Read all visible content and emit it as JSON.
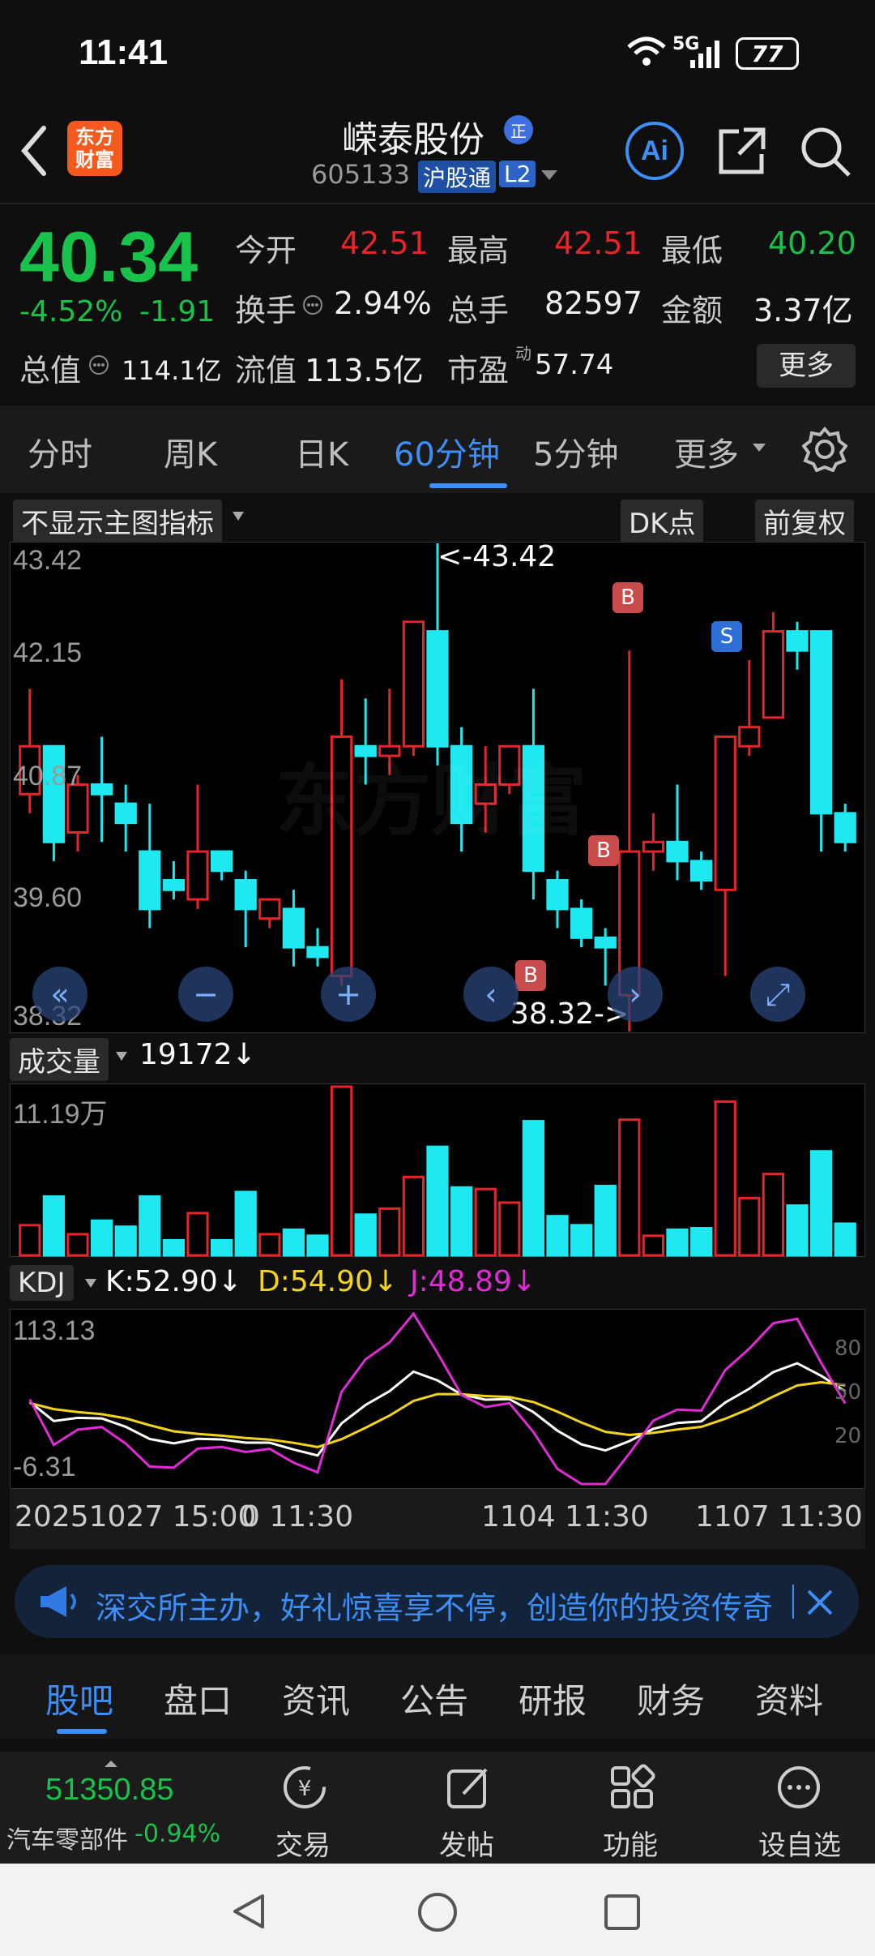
{
  "status_bar": {
    "time": "11:41",
    "network": "5G",
    "battery": "77"
  },
  "header": {
    "logo_line1": "东方",
    "logo_line2": "财富",
    "title": "嵘泰股份",
    "title_badge": "正",
    "code": "605133",
    "tag1": "沪股通",
    "tag2": "L2",
    "ai_label": "Ai"
  },
  "quote": {
    "price": "40.34",
    "change_pct": "-4.52%",
    "change": "-1.91",
    "open_label": "今开",
    "open": "42.51",
    "high_label": "最高",
    "high": "42.51",
    "low_label": "最低",
    "low": "40.20",
    "turnover_label": "换手",
    "turnover": "2.94%",
    "volume_label": "总手",
    "volume": "82597",
    "amount_label": "金额",
    "amount": "3.37亿",
    "mktcap_label": "总值",
    "mktcap": "114.1亿",
    "float_label": "流值",
    "float": "113.5亿",
    "pe_label": "市盈",
    "pe_sup": "动",
    "pe": "57.74",
    "more": "更多"
  },
  "tabs": [
    {
      "label": "分时"
    },
    {
      "label": "周K"
    },
    {
      "label": "日K"
    },
    {
      "label": "60分钟",
      "active": true
    },
    {
      "label": "5分钟"
    },
    {
      "label": "更多"
    }
  ],
  "chart_controls": {
    "indicator": "不显示主图指标",
    "dk": "DK点",
    "adjust": "前复权"
  },
  "chart_data": {
    "type": "candlestick",
    "price_axis": [
      "43.42",
      "42.15",
      "40.87",
      "39.60",
      "38.32"
    ],
    "max_annotation": "<-43.42",
    "min_annotation": "38.32->",
    "watermark": "东方财富",
    "markers": [
      {
        "label": "B"
      },
      {
        "label": "B"
      },
      {
        "label": "B"
      },
      {
        "label": "S"
      }
    ],
    "candles": [
      {
        "o": 40.8,
        "c": 41.3,
        "h": 41.9,
        "l": 40.6
      },
      {
        "o": 41.3,
        "c": 40.3,
        "h": 41.3,
        "l": 40.1
      },
      {
        "o": 40.4,
        "c": 40.9,
        "h": 41.0,
        "l": 40.2
      },
      {
        "o": 40.9,
        "c": 40.8,
        "h": 41.4,
        "l": 40.3
      },
      {
        "o": 40.7,
        "c": 40.5,
        "h": 40.9,
        "l": 40.2
      },
      {
        "o": 40.2,
        "c": 39.6,
        "h": 40.7,
        "l": 39.4
      },
      {
        "o": 39.9,
        "c": 39.8,
        "h": 40.1,
        "l": 39.7
      },
      {
        "o": 39.7,
        "c": 40.2,
        "h": 40.9,
        "l": 39.6
      },
      {
        "o": 40.2,
        "c": 40.0,
        "h": 40.2,
        "l": 39.9
      },
      {
        "o": 39.9,
        "c": 39.6,
        "h": 40.0,
        "l": 39.2
      },
      {
        "o": 39.5,
        "c": 39.7,
        "h": 39.7,
        "l": 39.4
      },
      {
        "o": 39.6,
        "c": 39.2,
        "h": 39.8,
        "l": 39.0
      },
      {
        "o": 39.2,
        "c": 39.1,
        "h": 39.4,
        "l": 39.0
      },
      {
        "o": 38.9,
        "c": 41.4,
        "h": 42.0,
        "l": 38.8
      },
      {
        "o": 41.3,
        "c": 41.2,
        "h": 41.8,
        "l": 40.9
      },
      {
        "o": 41.2,
        "c": 41.3,
        "h": 41.9,
        "l": 41.0
      },
      {
        "o": 41.3,
        "c": 42.6,
        "h": 42.6,
        "l": 41.2
      },
      {
        "o": 42.5,
        "c": 41.3,
        "h": 43.42,
        "l": 41.1
      },
      {
        "o": 41.3,
        "c": 40.5,
        "h": 41.5,
        "l": 40.2
      },
      {
        "o": 40.7,
        "c": 40.9,
        "h": 41.3,
        "l": 40.4
      },
      {
        "o": 40.9,
        "c": 41.3,
        "h": 41.3,
        "l": 40.8
      },
      {
        "o": 41.3,
        "c": 40.0,
        "h": 41.9,
        "l": 39.7
      },
      {
        "o": 39.9,
        "c": 39.6,
        "h": 40.0,
        "l": 39.4
      },
      {
        "o": 39.6,
        "c": 39.3,
        "h": 39.7,
        "l": 39.2
      },
      {
        "o": 39.3,
        "c": 39.2,
        "h": 39.4,
        "l": 38.8
      },
      {
        "o": 38.7,
        "c": 40.2,
        "h": 42.3,
        "l": 38.32
      },
      {
        "o": 40.2,
        "c": 40.3,
        "h": 40.6,
        "l": 40.0
      },
      {
        "o": 40.3,
        "c": 40.1,
        "h": 40.9,
        "l": 39.9
      },
      {
        "o": 40.1,
        "c": 39.9,
        "h": 40.2,
        "l": 39.8
      },
      {
        "o": 39.8,
        "c": 41.4,
        "h": 41.4,
        "l": 38.9
      },
      {
        "o": 41.3,
        "c": 41.5,
        "h": 42.2,
        "l": 41.2
      },
      {
        "o": 41.6,
        "c": 42.5,
        "h": 42.7,
        "l": 41.6
      },
      {
        "o": 42.5,
        "c": 42.3,
        "h": 42.6,
        "l": 42.1
      },
      {
        "o": 42.5,
        "c": 40.6,
        "h": 42.5,
        "l": 40.2
      },
      {
        "o": 40.6,
        "c": 40.3,
        "h": 40.7,
        "l": 40.2
      }
    ],
    "volume_label": "成交量",
    "volume_value": "19172",
    "volume_arrow": "↓",
    "volume_axis_max": "11.19万",
    "volumes": [
      2.0,
      3.9,
      1.4,
      2.3,
      1.9,
      3.9,
      1.0,
      2.8,
      1.0,
      4.2,
      1.4,
      1.7,
      1.3,
      11.19,
      2.7,
      3.1,
      5.2,
      7.2,
      4.5,
      4.4,
      3.5,
      8.9,
      2.6,
      2.0,
      4.6,
      9.0,
      1.3,
      1.7,
      1.8,
      10.2,
      3.8,
      5.4,
      3.3,
      6.9,
      2.1
    ],
    "kdj": {
      "label": "KDJ",
      "k": "K:52.90↓",
      "d": "D:54.90↓",
      "j": "J:48.89↓",
      "axis_top": "113.13",
      "axis_bottom": "-6.31",
      "right_ticks": [
        "80",
        "50",
        "20"
      ]
    },
    "time_axis": [
      "20251027 15:00",
      "0 11:30",
      "1104 11:30",
      "1107 11:30"
    ]
  },
  "banner": {
    "text": "深交所主办，好礼惊喜享不停，创造你的投资传奇"
  },
  "sub_tabs": [
    {
      "label": "股吧",
      "active": true
    },
    {
      "label": "盘口"
    },
    {
      "label": "资讯"
    },
    {
      "label": "公告"
    },
    {
      "label": "研报"
    },
    {
      "label": "财务"
    },
    {
      "label": "资料"
    }
  ],
  "dock": {
    "index_value": "51350.85",
    "index_name": "汽车零部件",
    "index_change": "-0.94%",
    "items": [
      {
        "label": "交易"
      },
      {
        "label": "发帖"
      },
      {
        "label": "功能"
      },
      {
        "label": "设自选"
      }
    ]
  },
  "colors": {
    "up": "#e8232a",
    "down": "#1ee8f0",
    "accent": "#3d8ef5",
    "green": "#19c24a",
    "k_line": "#ffffff",
    "d_line": "#f2d41c",
    "j_line": "#e02bd6"
  }
}
